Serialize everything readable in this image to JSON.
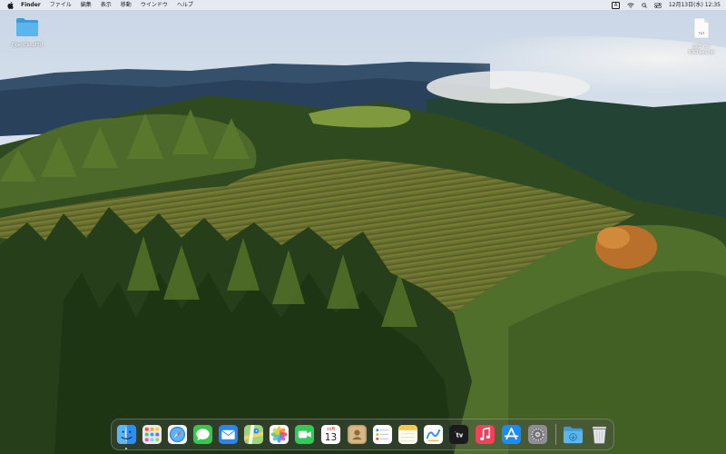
{
  "menubar": {
    "app_name": "Finder",
    "menus": [
      "ファイル",
      "編集",
      "表示",
      "移動",
      "ウインドウ",
      "ヘルプ"
    ],
    "status": {
      "input_source": "A",
      "datetime": "12月13日(水)  12:35"
    }
  },
  "desktop": {
    "icons": [
      {
        "name": "OpenCloudTU",
        "kind": "folder",
        "label": "OpenCloudTU"
      },
      {
        "name": "id-password-txt",
        "kind": "text-file",
        "badge": "TXT",
        "label": "ログイン\nID&Pass.txt"
      }
    ]
  },
  "dock": {
    "calendar": {
      "month": "12月",
      "day": "13"
    },
    "apps": [
      {
        "name": "Finder",
        "icon": "finder-icon",
        "running": true
      },
      {
        "name": "Launchpad",
        "icon": "launchpad-icon",
        "running": false
      },
      {
        "name": "Safari",
        "icon": "safari-icon",
        "running": false
      },
      {
        "name": "Messages",
        "icon": "messages-icon",
        "running": false
      },
      {
        "name": "Mail",
        "icon": "mail-icon",
        "running": false
      },
      {
        "name": "Maps",
        "icon": "maps-icon",
        "running": false
      },
      {
        "name": "Photos",
        "icon": "photos-icon",
        "running": false
      },
      {
        "name": "FaceTime",
        "icon": "facetime-icon",
        "running": false
      },
      {
        "name": "Calendar",
        "icon": "calendar-icon",
        "running": false
      },
      {
        "name": "Contacts",
        "icon": "contacts-icon",
        "running": false
      },
      {
        "name": "Reminders",
        "icon": "reminders-icon",
        "running": false
      },
      {
        "name": "Notes",
        "icon": "notes-icon",
        "running": false
      },
      {
        "name": "Freeform",
        "icon": "freeform-icon",
        "running": false
      },
      {
        "name": "TV",
        "icon": "tv-icon",
        "label": "tv",
        "running": false
      },
      {
        "name": "Music",
        "icon": "music-icon",
        "running": false
      },
      {
        "name": "App Store",
        "icon": "app-store-icon",
        "running": false
      },
      {
        "name": "System Settings",
        "icon": "settings-icon",
        "running": false
      },
      {
        "name": "Downloads",
        "icon": "downloads-folder-icon",
        "running": false
      },
      {
        "name": "Trash",
        "icon": "trash-icon",
        "running": false
      }
    ]
  },
  "colors": {
    "folder_blue": "#4aa8e8",
    "dock_bg": "rgba(80,80,80,0.35)",
    "menubar_bg": "rgba(235,238,243,0.82)"
  }
}
